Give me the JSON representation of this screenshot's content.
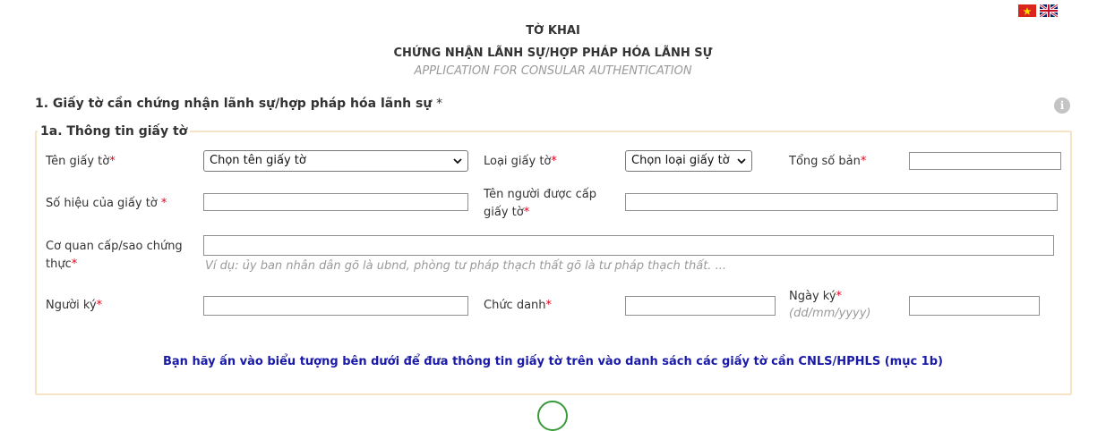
{
  "header": {
    "title": "TỜ KHAI",
    "subtitle": "CHỨNG NHẬN LÃNH SỰ/HỢP PHÁP HÓA LÃNH SỰ",
    "subtitle_en": "APPLICATION FOR CONSULAR AUTHENTICATION"
  },
  "languages": [
    {
      "code": "vi",
      "icon": "vietnam-flag-icon"
    },
    {
      "code": "en",
      "icon": "uk-flag-icon"
    }
  ],
  "section1": {
    "title": "1. Giấy tờ cần chứng nhận lãnh sự/hợp pháp hóa lãnh sự",
    "required_mark": "*",
    "info_icon": "i"
  },
  "section1a": {
    "legend": "1a. Thông tin giấy tờ",
    "fields": {
      "doc_name": {
        "label": "Tên giấy tờ",
        "value": "Chọn tên giấy tờ"
      },
      "doc_type": {
        "label": "Loại giấy tờ",
        "value": "Chọn loại giấy tờ"
      },
      "copies": {
        "label": "Tổng số bản",
        "value": ""
      },
      "doc_number": {
        "label": "Số hiệu của giấy tờ ",
        "value": ""
      },
      "issued_to": {
        "label": "Tên người được cấp giấy tờ",
        "value": ""
      },
      "issuer": {
        "label": "Cơ quan cấp/sao chứng thực",
        "value": "",
        "hint": "Ví dụ: ủy ban nhân dân gõ là ubnd, phòng tư pháp thạch thất gõ là tư pháp thạch thất. ..."
      },
      "signer": {
        "label": "Người ký",
        "value": ""
      },
      "position": {
        "label": "Chức danh",
        "value": ""
      },
      "sign_date": {
        "label": "Ngày ký",
        "hint": "(dd/mm/yyyy)",
        "value": ""
      }
    },
    "required_mark": "*",
    "notice": "Bạn hãy ấn vào biểu tượng bên dưới để đưa thông tin giấy tờ trên vào danh sách các giấy tờ cần CNLS/HPHLS (mục 1b)"
  }
}
